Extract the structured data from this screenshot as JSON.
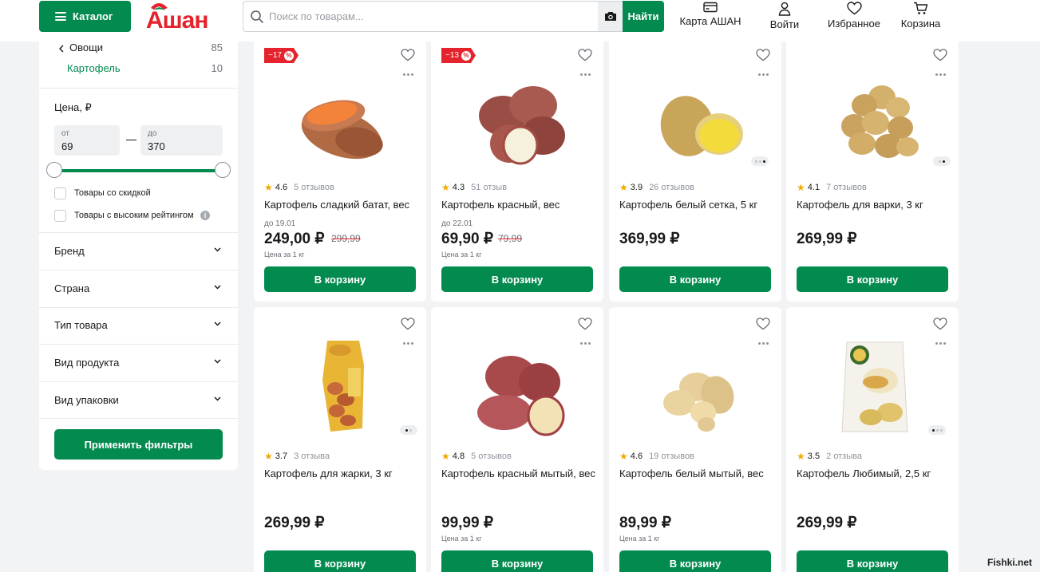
{
  "header": {
    "catalog_label": "Каталог",
    "logo_text": "Ашан",
    "search_placeholder": "Поиск по товарам...",
    "find_label": "Найти",
    "nav": [
      {
        "label": "Карта АШАН",
        "icon": "card-icon"
      },
      {
        "label": "Войти",
        "icon": "user-icon"
      },
      {
        "label": "Избранное",
        "icon": "heart-icon"
      },
      {
        "label": "Корзина",
        "icon": "cart-icon"
      }
    ]
  },
  "sidebar": {
    "categories": [
      {
        "label": "Овощи",
        "count": "85"
      },
      {
        "label": "Картофель",
        "count": "10"
      }
    ],
    "price": {
      "title": "Цена, ₽",
      "from_label": "от",
      "from_value": "69",
      "to_label": "до",
      "to_value": "370"
    },
    "checkboxes": [
      {
        "label": "Товары со скидкой",
        "checked": false
      },
      {
        "label": "Товары с высоким рейтингом",
        "checked": false
      }
    ],
    "facets": [
      "Бренд",
      "Страна",
      "Тип товара",
      "Вид продукта",
      "Вид упаковки"
    ],
    "apply_label": "Применить фильтры"
  },
  "products": [
    {
      "name": "Картофель сладкий батат, вес",
      "rating": "4.6",
      "reviews": "5 отзывов",
      "discount": "−17",
      "until": "до 19.01",
      "price": "249,00 ₽",
      "old_price": "299,99",
      "unit": "Цена за 1 кг",
      "button": "В корзину"
    },
    {
      "name": "Картофель красный, вес",
      "rating": "4.3",
      "reviews": "51 отзыв",
      "discount": "−13",
      "until": "до 22.01",
      "price": "69,90 ₽",
      "old_price": "79,99",
      "unit": "Цена за 1 кг",
      "button": "В корзину"
    },
    {
      "name": "Картофель белый сетка, 5 кг",
      "rating": "3.9",
      "reviews": "26 отзывов",
      "price": "369,99 ₽",
      "button": "В корзину"
    },
    {
      "name": "Картофель для варки, 3 кг",
      "rating": "4.1",
      "reviews": "7 отзывов",
      "price": "269,99 ₽",
      "button": "В корзину"
    },
    {
      "name": "Картофель для жарки, 3 кг",
      "rating": "3.7",
      "reviews": "3 отзыва",
      "price": "269,99 ₽",
      "button": "В корзину"
    },
    {
      "name": "Картофель красный мытый, вес",
      "rating": "4.8",
      "reviews": "5 отзывов",
      "price": "99,99 ₽",
      "unit": "Цена за 1 кг",
      "button": "В корзину"
    },
    {
      "name": "Картофель белый мытый, вес",
      "rating": "4.6",
      "reviews": "19 отзывов",
      "price": "89,99 ₽",
      "unit": "Цена за 1 кг",
      "button": "В корзину"
    },
    {
      "name": "Картофель Любимый, 2,5 кг",
      "rating": "3.5",
      "reviews": "2 отзыва",
      "price": "269,99 ₽",
      "button": "В корзину"
    }
  ],
  "watermark": "Fishki.net",
  "colors": {
    "brand_green": "#038a4f",
    "brand_red": "#e4232c",
    "star": "#f2a900"
  }
}
